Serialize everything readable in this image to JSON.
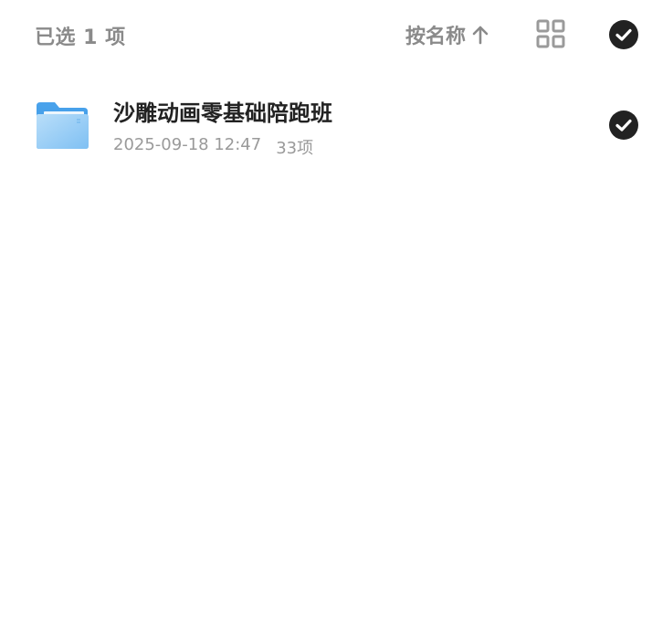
{
  "toolbar": {
    "selected_text": "已选 1 项",
    "sort_label": "按名称",
    "sort_icon": "arrow-up-icon",
    "view_icon": "grid-view-icon",
    "select_all_icon": "check-circle-icon",
    "select_all_checked": true
  },
  "files": [
    {
      "name": "沙雕动画零基础陪跑班",
      "date": "2025-09-18 12:47",
      "count": "33项",
      "type_icon": "folder-icon",
      "checked": true
    }
  ],
  "colors": {
    "text_primary": "#222222",
    "text_secondary": "#9a9a9a",
    "toolbar_text": "#8a8a8a",
    "check_fill": "#222222",
    "folder_light": "#9dd0f7",
    "folder_dark": "#4fa8ee"
  }
}
